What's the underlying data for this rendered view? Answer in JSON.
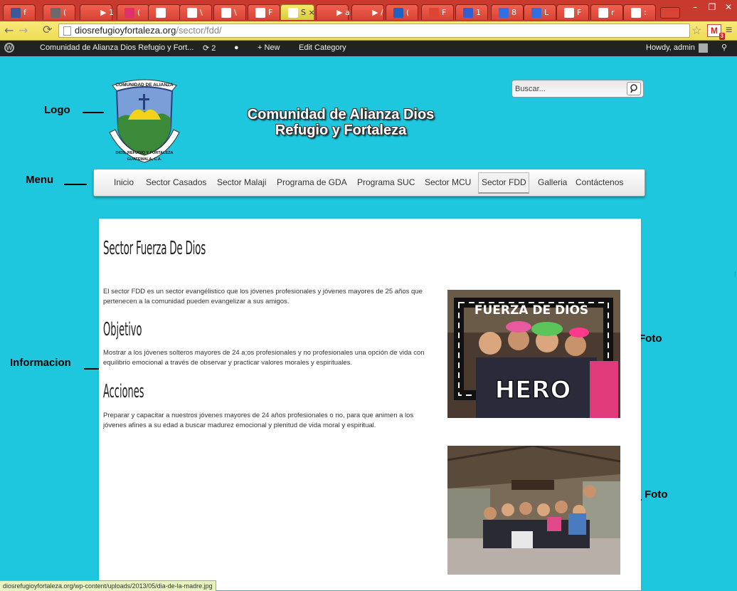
{
  "browser": {
    "tabs": [
      {
        "label": "f",
        "fav": "#3b5998"
      },
      {
        "label": "(",
        "fav": "#6b6b6b"
      },
      {
        "label": "▶ 1",
        "fav": ""
      },
      {
        "label": "(",
        "fav": "#e0306e"
      },
      {
        "label": "",
        "fav": "#ffffff"
      },
      {
        "label": "\\",
        "fav": "#ffffff"
      },
      {
        "label": "\\",
        "fav": "#ffffff"
      },
      {
        "label": "F",
        "fav": "#ffffff"
      },
      {
        "label": "S ×",
        "fav": "#ffffff",
        "active": true
      },
      {
        "label": "▶ a",
        "fav": ""
      },
      {
        "label": "▶ /",
        "fav": ""
      },
      {
        "label": "(",
        "fav": "#2060c0"
      },
      {
        "label": "F",
        "fav": "#dd4433"
      },
      {
        "label": "1",
        "fav": "#3060d0"
      },
      {
        "label": "8",
        "fav": "#3070e0"
      },
      {
        "label": "L",
        "fav": "#3070e0"
      },
      {
        "label": "F",
        "fav": "#ffffff"
      },
      {
        "label": "r",
        "fav": "#ffffff"
      },
      {
        "label": ":",
        "fav": "#ffffff"
      }
    ],
    "url_domain": "diosrefugioyfortaleza.org",
    "url_path": "/sector/fdd/",
    "status_url": "diosrefugioyfortaleza.org/wp-content/uploads/2013/05/dia-de-la-madre.jpg",
    "gmail_badge": "3"
  },
  "adminbar": {
    "site": "Comunidad de Alianza Dios Refugio y Fort...",
    "updates": "2",
    "new_label": "New",
    "edit_label": "Edit Category",
    "howdy": "Howdy, admin"
  },
  "header": {
    "title_line1": "Comunidad de Alianza Dios",
    "title_line2": "Refugio y Fortaleza",
    "search_placeholder": "Buscar...",
    "logo_text_top": "COMUNIDAD DE ALIANZA",
    "logo_text_bottom": "DIOS, REFUGIO Y FORTALEZA",
    "logo_text_country": "GUATEMALA, C.A."
  },
  "nav": {
    "items": [
      "Inicio",
      "Sector Casados",
      "Sector Malaji",
      "Programa de GDA",
      "Programa SUC",
      "Sector MCU",
      "Sector FDD",
      "Galleria",
      "Contáctenos"
    ],
    "active": "Sector FDD"
  },
  "annotations": {
    "logo": "Logo",
    "menu": "Menu",
    "info": "Informacion",
    "foto1": "Foto",
    "foto2": "Foto"
  },
  "content": {
    "page_title": "Sector Fuerza De Dios",
    "intro": "El sector FDD es un sector evangélistico que los jóvenes profesionales y jóvenes mayores de 25 años que pertenecen a la comunidad pueden evangelizar a sus amigos.",
    "h_objetivo": "Objetivo",
    "objetivo": "Mostrar a los jóvenes solteros mayores de 24 a;os profesionales y no profesionales una opción de vida con equilibrio emocional a través de observar y practicar valores morales y espirituales.",
    "h_acciones": "Acciones",
    "acciones": "Preparar y capacitar a nuestros jóvenes mayores de 24 años  profesionales o no,  para que animen a los jóvenes afines a su edad a buscar madurez emocional y plenitud de vida moral y espiritual.",
    "photo1_text_top": "FUERZA DE DIOS",
    "photo1_text_bottom": "HERO"
  }
}
